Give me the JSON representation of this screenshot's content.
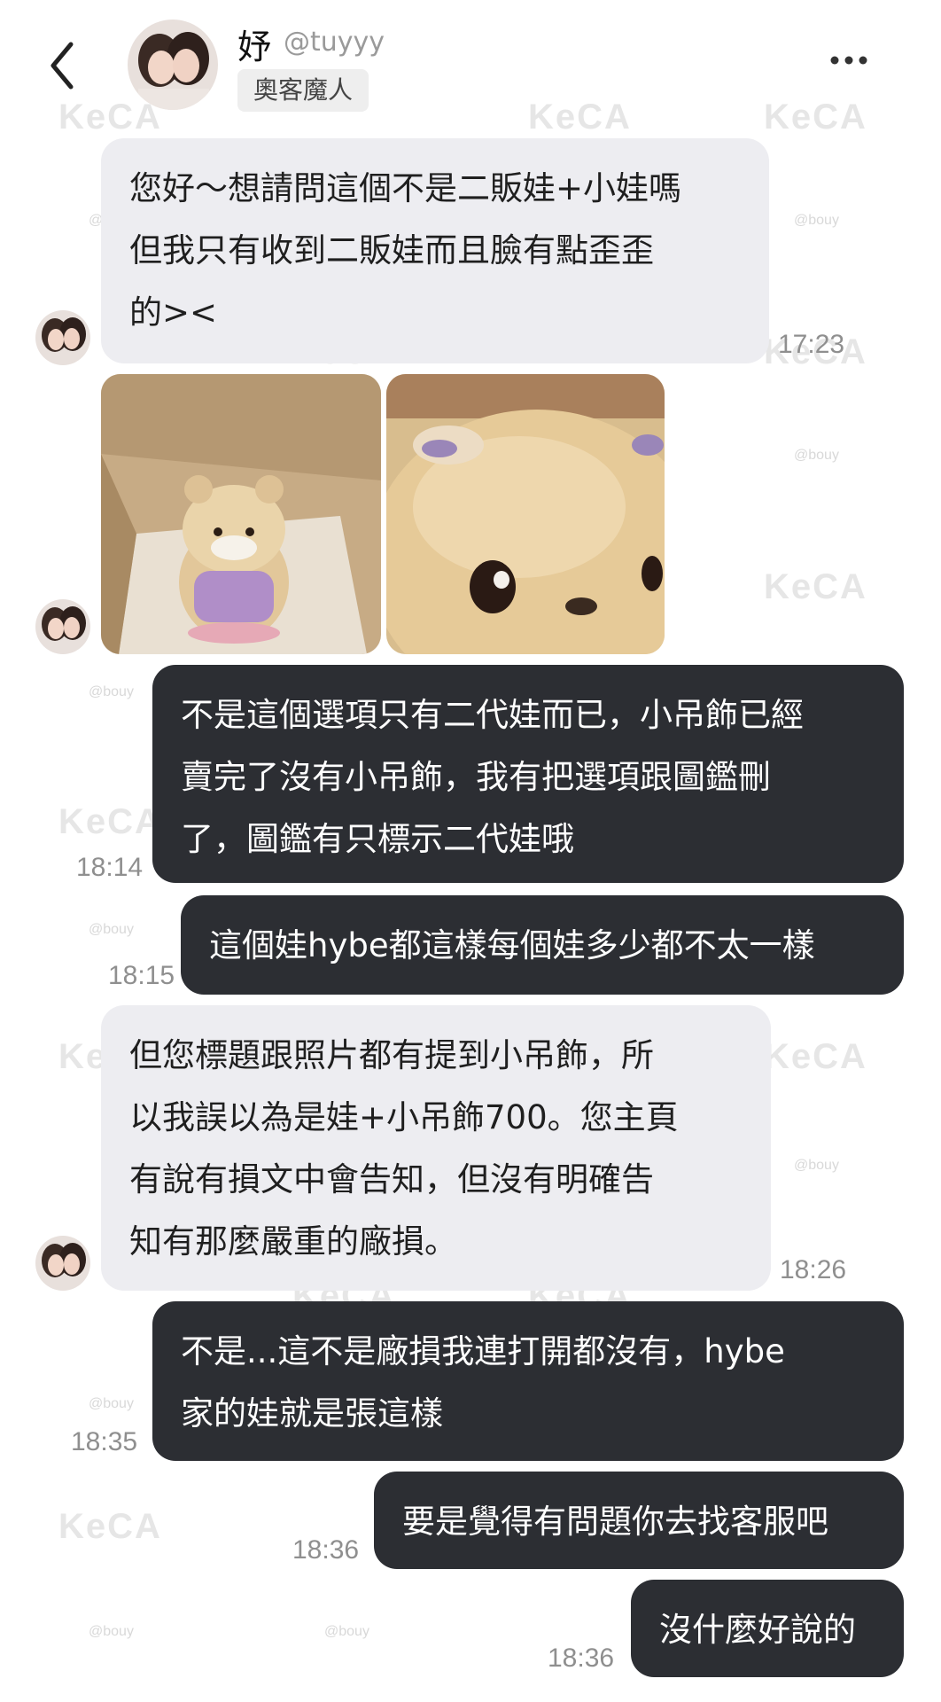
{
  "header": {
    "back_icon": "chevron-left-icon",
    "name": "妤",
    "handle": "@tuyyy",
    "badge": "奧客魔人",
    "more_icon": "more-horizontal-icon"
  },
  "watermark": {
    "logo": "KeCA",
    "handle": "@bouy"
  },
  "messages": [
    {
      "side": "incoming",
      "text": "您好～想請問這個不是二販娃+小娃嗎\n但我只有收到二販娃而且臉有點歪歪\n的><",
      "time": "17:23"
    },
    {
      "side": "incoming",
      "type": "images",
      "images": [
        "plush-doll-in-box-photo",
        "plush-doll-face-closeup-photo"
      ]
    },
    {
      "side": "outgoing",
      "text": "不是這個選項只有二代娃而已，小吊飾已經\n賣完了沒有小吊飾，我有把選項跟圖鑑刪\n了，圖鑑有只標示二代娃哦",
      "time": "18:14"
    },
    {
      "side": "outgoing",
      "text": "這個娃hybe都這樣每個娃多少都不太一樣",
      "time": "18:15"
    },
    {
      "side": "incoming",
      "text": "但您標題跟照片都有提到小吊飾，所\n以我誤以為是娃+小吊飾700。您主頁\n有說有損文中會告知，但沒有明確告\n知有那麼嚴重的廠損。",
      "time": "18:26"
    },
    {
      "side": "outgoing",
      "text": "不是...這不是廠損我連打開都沒有，hybe\n家的娃就是張這樣",
      "time": "18:35"
    },
    {
      "side": "outgoing",
      "text": "要是覺得有問題你去找客服吧",
      "time": "18:36"
    },
    {
      "side": "outgoing",
      "text": "沒什麼好說的",
      "time": "18:36"
    }
  ],
  "colors": {
    "incoming_bubble": "#ededf1",
    "outgoing_bubble": "#2c2e33",
    "timestamp": "#8f8f8f"
  }
}
